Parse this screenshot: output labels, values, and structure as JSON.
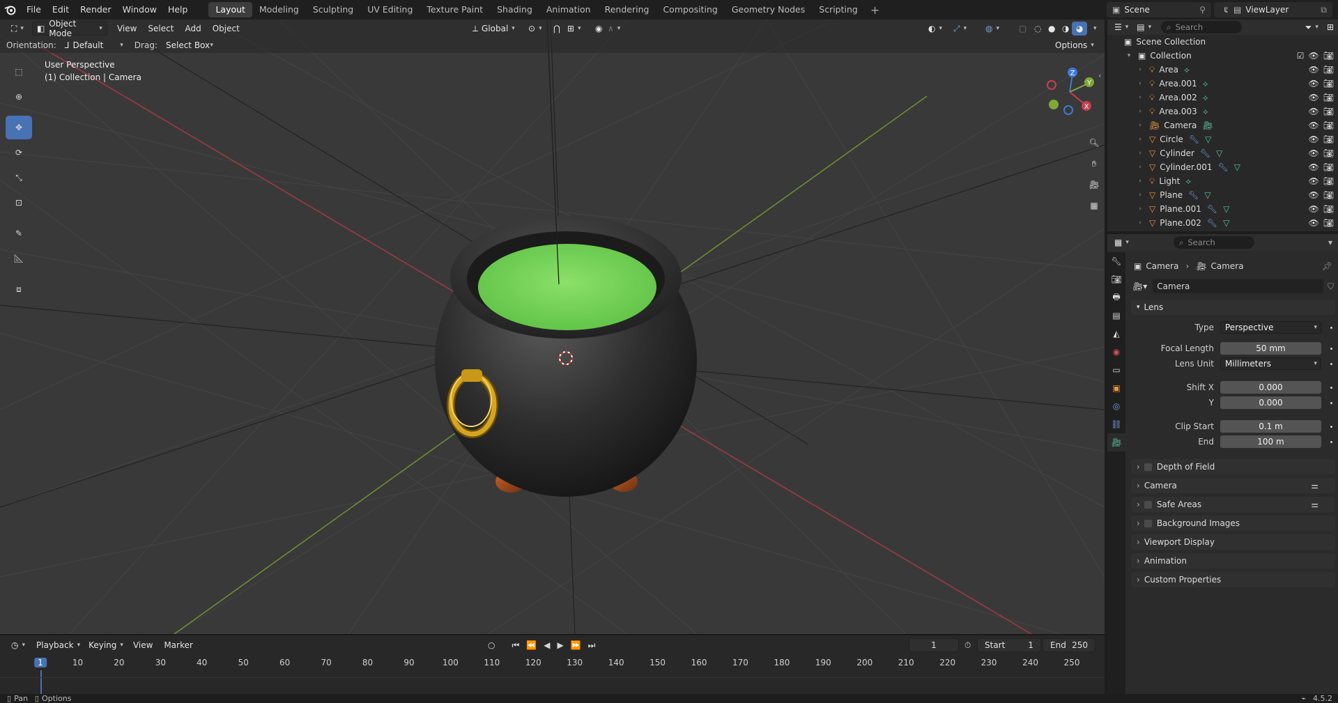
{
  "menu": [
    "File",
    "Edit",
    "Render",
    "Window",
    "Help"
  ],
  "workspaces": [
    "Layout",
    "Modeling",
    "Sculpting",
    "UV Editing",
    "Texture Paint",
    "Shading",
    "Animation",
    "Rendering",
    "Compositing",
    "Geometry Nodes",
    "Scripting"
  ],
  "active_workspace": "Layout",
  "scene": "Scene",
  "view_layer": "ViewLayer",
  "viewport": {
    "mode": "Object Mode",
    "menus": [
      "View",
      "Select",
      "Add",
      "Object"
    ],
    "transform": "Global",
    "orientation_label": "Orientation:",
    "orientation": "Default",
    "drag_label": "Drag:",
    "drag": "Select Box",
    "options": "Options",
    "overlay_line1": "User Perspective",
    "overlay_line2": "(1) Collection | Camera",
    "gizmo_z": "Z",
    "gizmo_y": "Y",
    "gizmo_x": "X"
  },
  "timeline": {
    "menus": [
      "Playback",
      "Keying",
      "View",
      "Marker"
    ],
    "current_frame": "1",
    "start_label": "Start",
    "start": "1",
    "end_label": "End",
    "end": "250",
    "ticks": [
      "10",
      "20",
      "30",
      "40",
      "50",
      "60",
      "70",
      "80",
      "90",
      "100",
      "110",
      "120",
      "130",
      "140",
      "150",
      "160",
      "170",
      "180",
      "190",
      "200",
      "210",
      "220",
      "230",
      "240",
      "250"
    ]
  },
  "status": {
    "pan": "Pan",
    "options": "Options",
    "version": "4.5.2"
  },
  "outliner": {
    "search_placeholder": "Search",
    "scene_collection": "Scene Collection",
    "collection": "Collection",
    "items": [
      {
        "name": "Area",
        "type": "light"
      },
      {
        "name": "Area.001",
        "type": "light"
      },
      {
        "name": "Area.002",
        "type": "light"
      },
      {
        "name": "Area.003",
        "type": "light"
      },
      {
        "name": "Camera",
        "type": "camera"
      },
      {
        "name": "Circle",
        "type": "mesh"
      },
      {
        "name": "Cylinder",
        "type": "mesh"
      },
      {
        "name": "Cylinder.001",
        "type": "mesh"
      },
      {
        "name": "Light",
        "type": "light"
      },
      {
        "name": "Plane",
        "type": "mesh"
      },
      {
        "name": "Plane.001",
        "type": "mesh"
      },
      {
        "name": "Plane.002",
        "type": "mesh"
      }
    ]
  },
  "properties": {
    "search_placeholder": "Search",
    "breadcrumb_object": "Camera",
    "breadcrumb_data": "Camera",
    "datablock": "Camera",
    "lens_panel": "Lens",
    "type_label": "Type",
    "type": "Perspective",
    "focal_label": "Focal Length",
    "focal": "50 mm",
    "lens_unit_label": "Lens Unit",
    "lens_unit": "Millimeters",
    "shift_x_label": "Shift X",
    "shift_x": "0.000",
    "shift_y_label": "Y",
    "shift_y": "0.000",
    "clip_start_label": "Clip Start",
    "clip_start": "0.1 m",
    "clip_end_label": "End",
    "clip_end": "100 m",
    "subpanels": [
      "Depth of Field",
      "Camera",
      "Safe Areas",
      "Background Images",
      "Viewport Display",
      "Animation",
      "Custom Properties"
    ]
  },
  "colors": {
    "accent": "#4772b3",
    "liquid": "#7ed860",
    "gold": "#d4a520",
    "x_axis": "#c64050",
    "y_axis": "#7fa83a"
  }
}
